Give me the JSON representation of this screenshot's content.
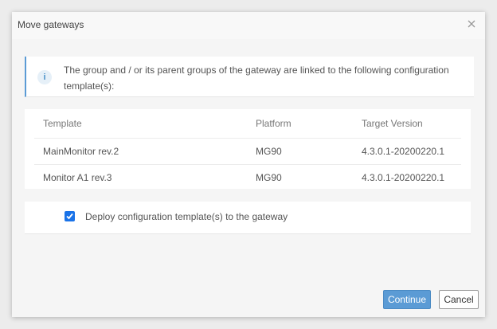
{
  "dialog": {
    "title": "Move gateways",
    "close_icon": "close-icon"
  },
  "info": {
    "icon": "info-icon",
    "icon_glyph": "i",
    "message": "The group and / or its parent groups of the gateway are linked to the following configuration template(s):"
  },
  "table": {
    "headers": [
      "Template",
      "Platform",
      "Target Version"
    ],
    "rows": [
      {
        "template": "MainMonitor rev.2",
        "platform": "MG90",
        "version": "4.3.0.1-20200220.1"
      },
      {
        "template": "Monitor A1 rev.3",
        "platform": "MG90",
        "version": "4.3.0.1-20200220.1"
      }
    ]
  },
  "deploy": {
    "checked": true,
    "label": "Deploy configuration template(s) to the gateway"
  },
  "buttons": {
    "continue_label": "Continue",
    "cancel_label": "Cancel"
  },
  "colors": {
    "accent": "#5b9bd5",
    "checkbox": "#1a73e8"
  }
}
